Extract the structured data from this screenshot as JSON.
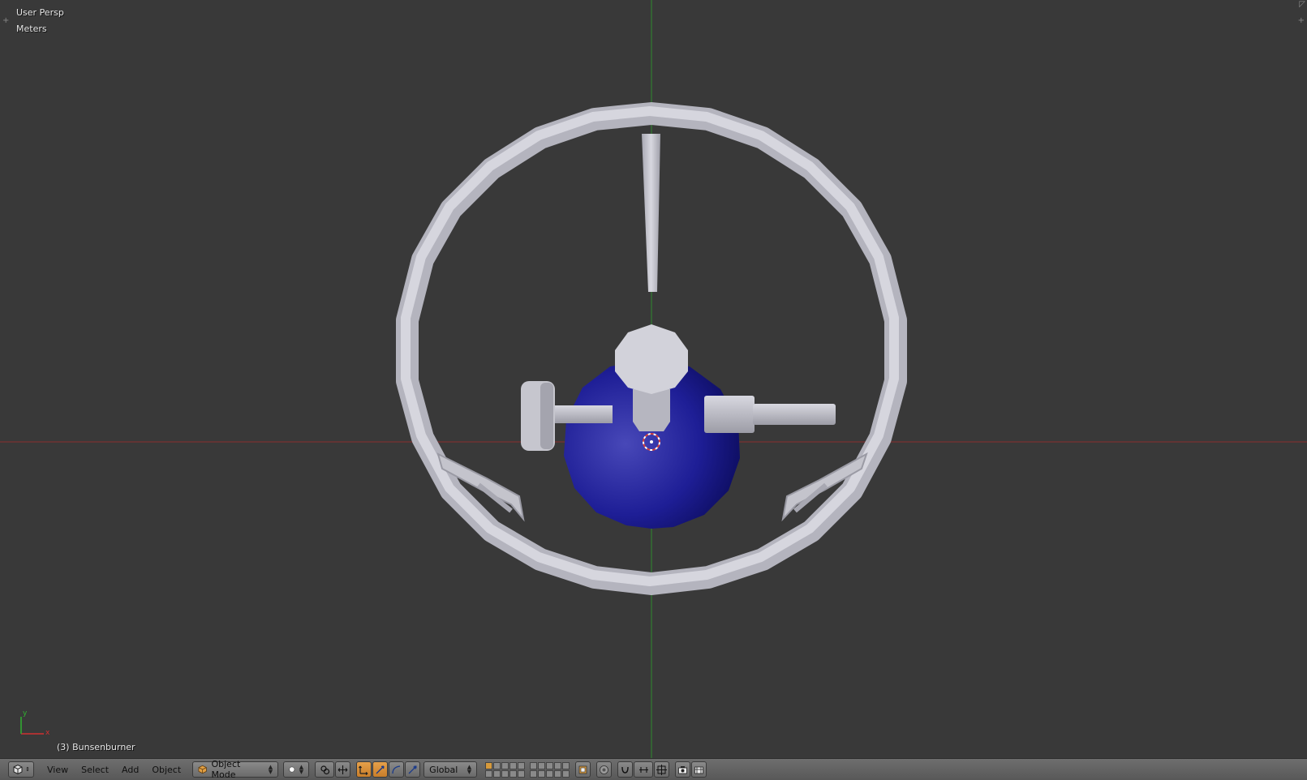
{
  "viewport": {
    "view_name": "User Persp",
    "units": "Meters",
    "object_info": "(3) Bunsenburner",
    "axis_x_label": "x",
    "axis_y_label": "y",
    "colors": {
      "background": "#393939",
      "x_axis": "#a83232",
      "y_axis": "#3c9a3c",
      "metal": "#c8c8d2",
      "flask": "#1a1a8c"
    }
  },
  "header": {
    "editor_type_icon": "3d-view-icon",
    "menu": [
      "View",
      "Select",
      "Add",
      "Object"
    ],
    "mode": "Object Mode",
    "shading_icon": "solid-sphere-icon",
    "pivot_icon": "pivot-point-icon",
    "manipulator_icons": [
      "manipulator-toggle-icon",
      "translate-icon",
      "rotate-icon",
      "scale-icon"
    ],
    "orientation": "Global",
    "tool_icons": [
      "lock-layers-icon",
      "proportional-edit-icon",
      "snap-icon",
      "snap-element-icon",
      "opengl-render-icon",
      "opengl-anim-icon"
    ]
  }
}
